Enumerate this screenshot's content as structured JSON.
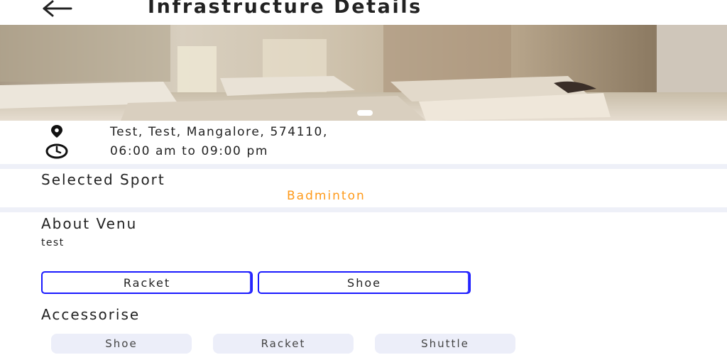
{
  "header": {
    "title": "Infrastructure Details",
    "back_icon": "arrow-left-icon"
  },
  "venue": {
    "address": "Test, Test, Mangalore, 574110,",
    "address_icon": "location-pin-icon",
    "hours": "06:00 am to 09:00 pm",
    "hours_icon": "clock-icon"
  },
  "selected_sport": {
    "label": "Selected Sport",
    "value": "Badminton"
  },
  "about": {
    "label": "About Venu",
    "text": "test"
  },
  "equipment_buttons": [
    {
      "label": "Racket"
    },
    {
      "label": "Shoe"
    }
  ],
  "accessories": {
    "label": "Accessorise",
    "items": [
      {
        "label": "Shoe"
      },
      {
        "label": "Racket"
      },
      {
        "label": "Shuttle"
      }
    ]
  },
  "colors": {
    "accent": "#ff9a1a",
    "button_border": "#1a1aff",
    "chip_bg": "#eceef9",
    "separator": "#eef0f8"
  }
}
